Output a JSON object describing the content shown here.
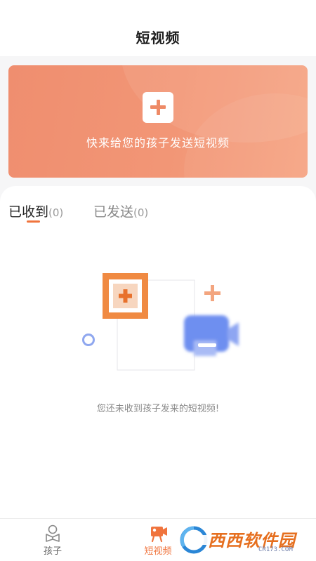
{
  "header": {
    "title": "短视频"
  },
  "banner": {
    "add_icon": "plus-icon",
    "caption": "快来给您的孩子发送短视频"
  },
  "tabs": [
    {
      "label": "已收到",
      "count": "(0)",
      "active": true
    },
    {
      "label": "已发送",
      "count": "(0)",
      "active": false
    }
  ],
  "empty_state": {
    "illustration": "empty-video-illustration",
    "message": "您还未收到孩子发来的短视频!"
  },
  "bottom_nav": [
    {
      "label": "孩子",
      "icon": "child-icon",
      "active": false
    },
    {
      "label": "短视频",
      "icon": "video-icon",
      "active": true
    }
  ],
  "watermark": {
    "text": "西西软件园",
    "url": "CR173.COM"
  },
  "colors": {
    "accent": "#f0743d",
    "banner": "#f29676",
    "illustration_blue": "#6e8ff0"
  }
}
